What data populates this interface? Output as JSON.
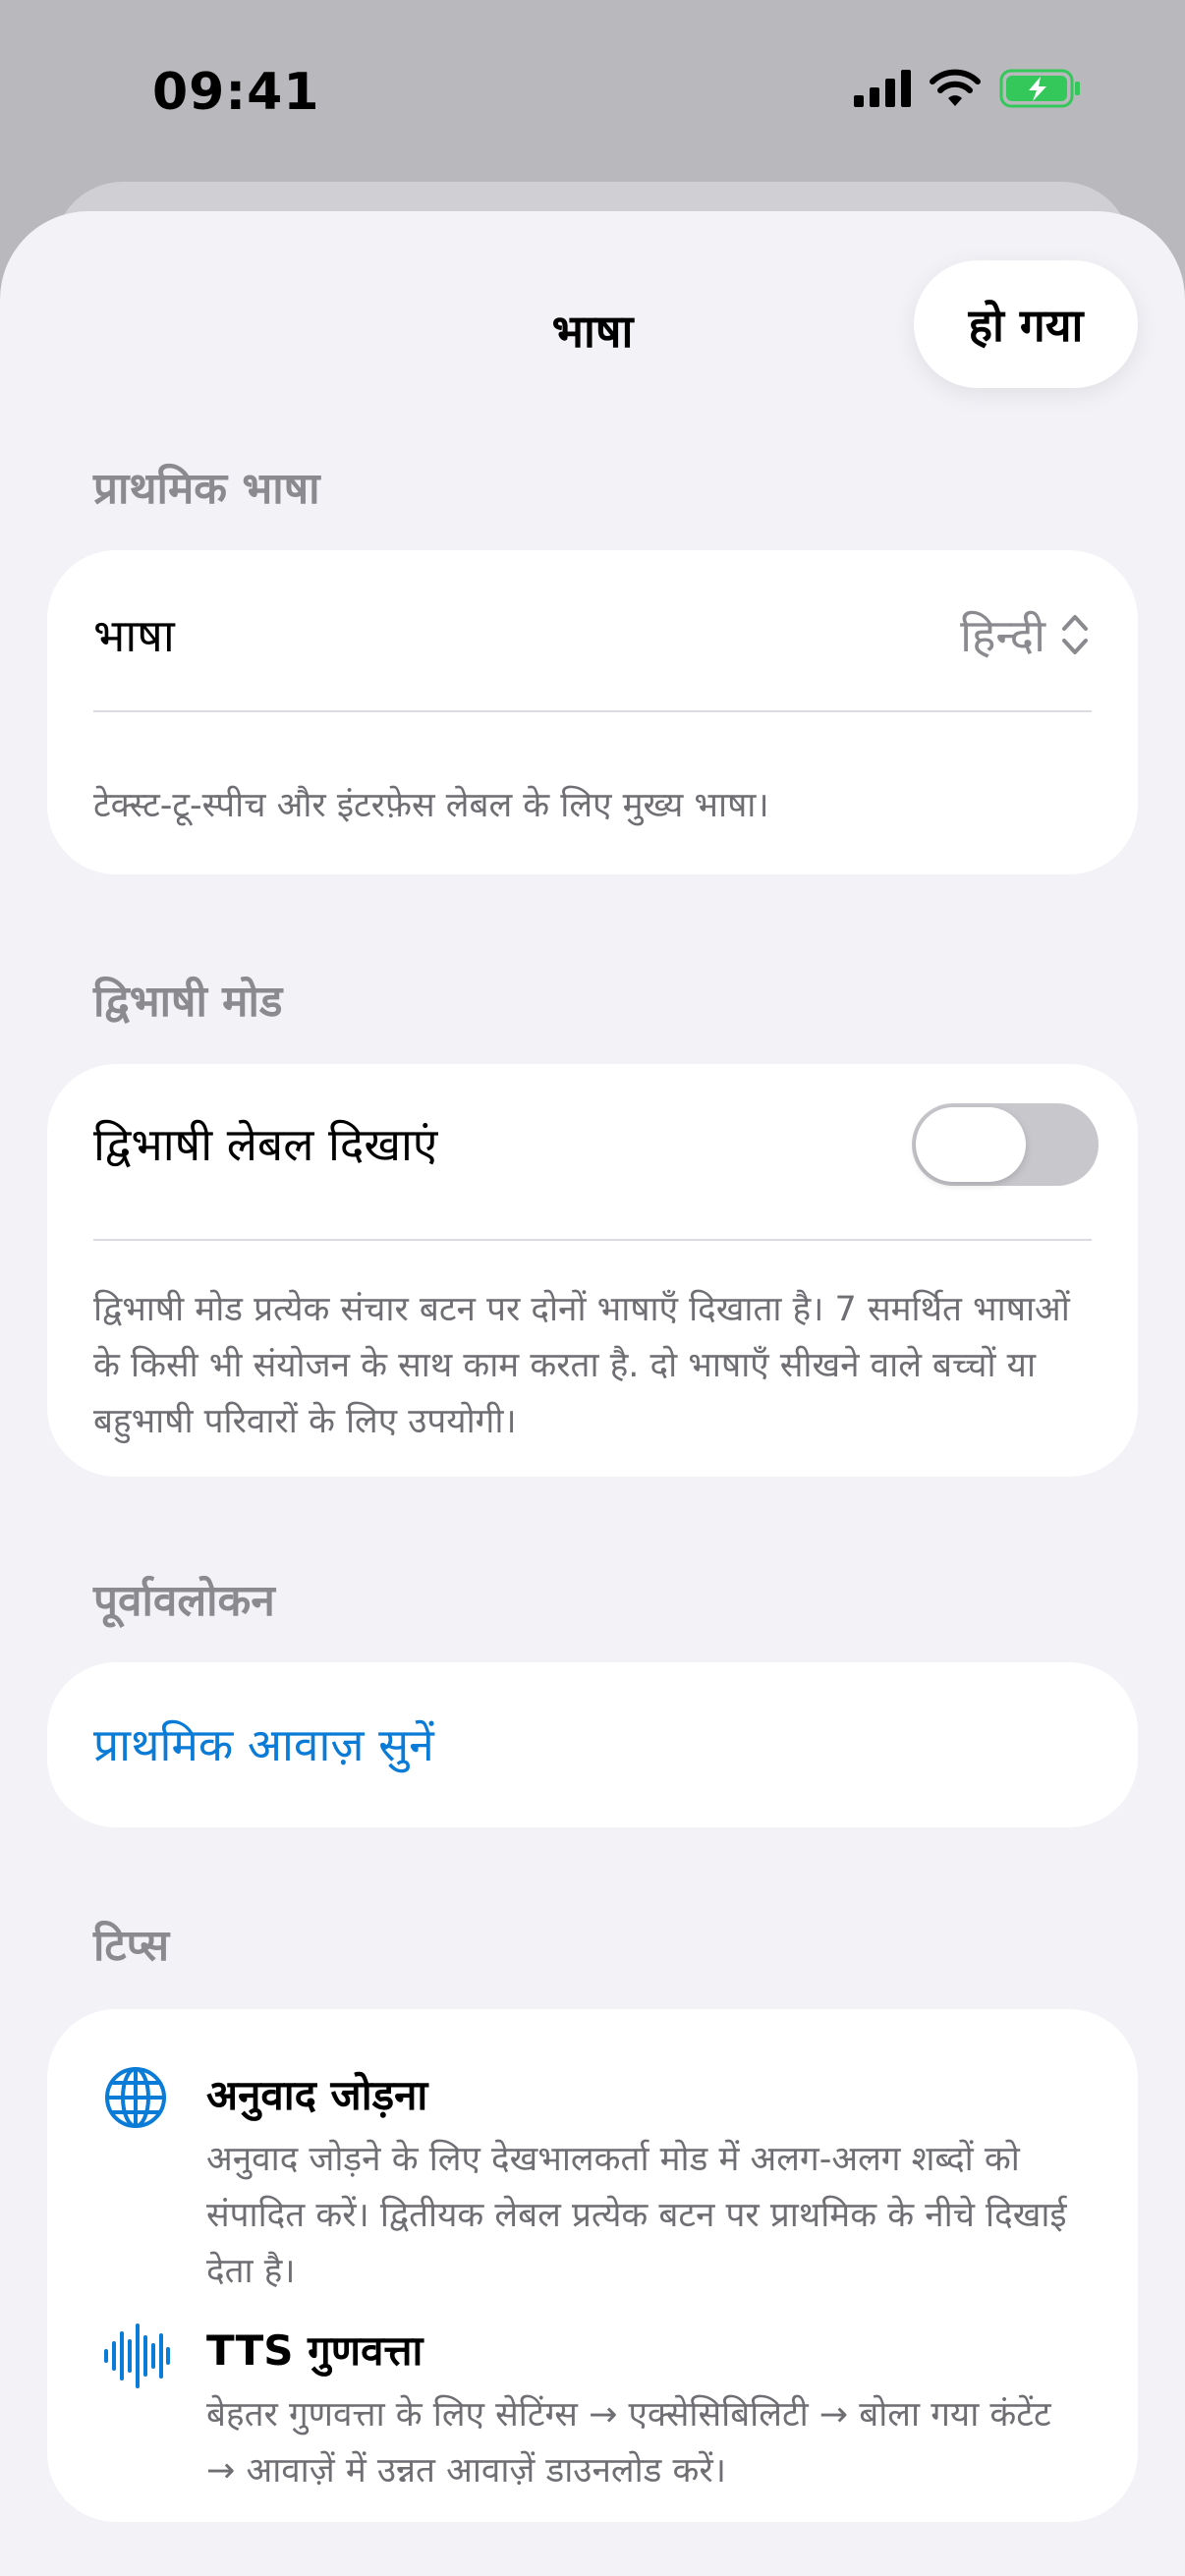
{
  "status_bar": {
    "time": "09:41"
  },
  "nav": {
    "title": "भाषा",
    "done_label": "हो गया"
  },
  "primary_language": {
    "header": "प्राथमिक भाषा",
    "row_label": "भाषा",
    "value": "हिन्दी",
    "footnote": "टेक्स्ट-टू-स्पीच और इंटरफ़ेस लेबल के लिए मुख्य भाषा।"
  },
  "bilingual": {
    "header": "द्विभाषी मोड",
    "toggle_label": "द्विभाषी लेबल दिखाएं",
    "toggle_on": false,
    "footnote": "द्विभाषी मोड प्रत्येक संचार बटन पर दोनों भाषाएँ दिखाता है। 7 समर्थित भाषाओं के किसी भी संयोजन के साथ काम करता है. दो भाषाएँ सीखने वाले बच्चों या बहुभाषी परिवारों के लिए उपयोगी।"
  },
  "preview": {
    "header": "पूर्वावलोकन",
    "link": "प्राथमिक आवाज़ सुनें"
  },
  "tips": {
    "header": "टिप्स",
    "items": [
      {
        "icon": "globe-icon",
        "title": "अनुवाद जोड़ना",
        "text": "अनुवाद जोड़ने के लिए देखभालकर्ता मोड में अलग-अलग शब्दों को संपादित करें। द्वितीयक लेबल प्रत्येक बटन पर प्राथमिक के नीचे दिखाई देता है।"
      },
      {
        "icon": "waveform-icon",
        "title": "TTS गुणवत्ता",
        "text": "बेहतर गुणवत्ता के लिए सेटिंग्स → एक्सेसिबिलिटी → बोला गया कंटेंट → आवाज़ें में उन्नत आवाज़ें डाउनलोड करें।"
      }
    ]
  },
  "colors": {
    "accent": "#0a7bd6",
    "background": "#f2f2f7",
    "secondary_text": "#6e6e73",
    "battery": "#34c759"
  }
}
